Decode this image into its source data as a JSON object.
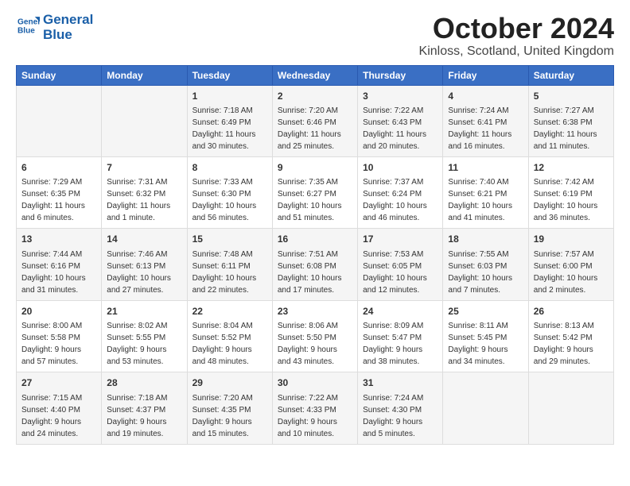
{
  "header": {
    "logo_line1": "General",
    "logo_line2": "Blue",
    "title": "October 2024",
    "subtitle": "Kinloss, Scotland, United Kingdom"
  },
  "calendar": {
    "days_of_week": [
      "Sunday",
      "Monday",
      "Tuesday",
      "Wednesday",
      "Thursday",
      "Friday",
      "Saturday"
    ],
    "weeks": [
      [
        {
          "day": "",
          "content": ""
        },
        {
          "day": "",
          "content": ""
        },
        {
          "day": "1",
          "content": "Sunrise: 7:18 AM\nSunset: 6:49 PM\nDaylight: 11 hours\nand 30 minutes."
        },
        {
          "day": "2",
          "content": "Sunrise: 7:20 AM\nSunset: 6:46 PM\nDaylight: 11 hours\nand 25 minutes."
        },
        {
          "day": "3",
          "content": "Sunrise: 7:22 AM\nSunset: 6:43 PM\nDaylight: 11 hours\nand 20 minutes."
        },
        {
          "day": "4",
          "content": "Sunrise: 7:24 AM\nSunset: 6:41 PM\nDaylight: 11 hours\nand 16 minutes."
        },
        {
          "day": "5",
          "content": "Sunrise: 7:27 AM\nSunset: 6:38 PM\nDaylight: 11 hours\nand 11 minutes."
        }
      ],
      [
        {
          "day": "6",
          "content": "Sunrise: 7:29 AM\nSunset: 6:35 PM\nDaylight: 11 hours\nand 6 minutes."
        },
        {
          "day": "7",
          "content": "Sunrise: 7:31 AM\nSunset: 6:32 PM\nDaylight: 11 hours\nand 1 minute."
        },
        {
          "day": "8",
          "content": "Sunrise: 7:33 AM\nSunset: 6:30 PM\nDaylight: 10 hours\nand 56 minutes."
        },
        {
          "day": "9",
          "content": "Sunrise: 7:35 AM\nSunset: 6:27 PM\nDaylight: 10 hours\nand 51 minutes."
        },
        {
          "day": "10",
          "content": "Sunrise: 7:37 AM\nSunset: 6:24 PM\nDaylight: 10 hours\nand 46 minutes."
        },
        {
          "day": "11",
          "content": "Sunrise: 7:40 AM\nSunset: 6:21 PM\nDaylight: 10 hours\nand 41 minutes."
        },
        {
          "day": "12",
          "content": "Sunrise: 7:42 AM\nSunset: 6:19 PM\nDaylight: 10 hours\nand 36 minutes."
        }
      ],
      [
        {
          "day": "13",
          "content": "Sunrise: 7:44 AM\nSunset: 6:16 PM\nDaylight: 10 hours\nand 31 minutes."
        },
        {
          "day": "14",
          "content": "Sunrise: 7:46 AM\nSunset: 6:13 PM\nDaylight: 10 hours\nand 27 minutes."
        },
        {
          "day": "15",
          "content": "Sunrise: 7:48 AM\nSunset: 6:11 PM\nDaylight: 10 hours\nand 22 minutes."
        },
        {
          "day": "16",
          "content": "Sunrise: 7:51 AM\nSunset: 6:08 PM\nDaylight: 10 hours\nand 17 minutes."
        },
        {
          "day": "17",
          "content": "Sunrise: 7:53 AM\nSunset: 6:05 PM\nDaylight: 10 hours\nand 12 minutes."
        },
        {
          "day": "18",
          "content": "Sunrise: 7:55 AM\nSunset: 6:03 PM\nDaylight: 10 hours\nand 7 minutes."
        },
        {
          "day": "19",
          "content": "Sunrise: 7:57 AM\nSunset: 6:00 PM\nDaylight: 10 hours\nand 2 minutes."
        }
      ],
      [
        {
          "day": "20",
          "content": "Sunrise: 8:00 AM\nSunset: 5:58 PM\nDaylight: 9 hours\nand 57 minutes."
        },
        {
          "day": "21",
          "content": "Sunrise: 8:02 AM\nSunset: 5:55 PM\nDaylight: 9 hours\nand 53 minutes."
        },
        {
          "day": "22",
          "content": "Sunrise: 8:04 AM\nSunset: 5:52 PM\nDaylight: 9 hours\nand 48 minutes."
        },
        {
          "day": "23",
          "content": "Sunrise: 8:06 AM\nSunset: 5:50 PM\nDaylight: 9 hours\nand 43 minutes."
        },
        {
          "day": "24",
          "content": "Sunrise: 8:09 AM\nSunset: 5:47 PM\nDaylight: 9 hours\nand 38 minutes."
        },
        {
          "day": "25",
          "content": "Sunrise: 8:11 AM\nSunset: 5:45 PM\nDaylight: 9 hours\nand 34 minutes."
        },
        {
          "day": "26",
          "content": "Sunrise: 8:13 AM\nSunset: 5:42 PM\nDaylight: 9 hours\nand 29 minutes."
        }
      ],
      [
        {
          "day": "27",
          "content": "Sunrise: 7:15 AM\nSunset: 4:40 PM\nDaylight: 9 hours\nand 24 minutes."
        },
        {
          "day": "28",
          "content": "Sunrise: 7:18 AM\nSunset: 4:37 PM\nDaylight: 9 hours\nand 19 minutes."
        },
        {
          "day": "29",
          "content": "Sunrise: 7:20 AM\nSunset: 4:35 PM\nDaylight: 9 hours\nand 15 minutes."
        },
        {
          "day": "30",
          "content": "Sunrise: 7:22 AM\nSunset: 4:33 PM\nDaylight: 9 hours\nand 10 minutes."
        },
        {
          "day": "31",
          "content": "Sunrise: 7:24 AM\nSunset: 4:30 PM\nDaylight: 9 hours\nand 5 minutes."
        },
        {
          "day": "",
          "content": ""
        },
        {
          "day": "",
          "content": ""
        }
      ]
    ]
  }
}
